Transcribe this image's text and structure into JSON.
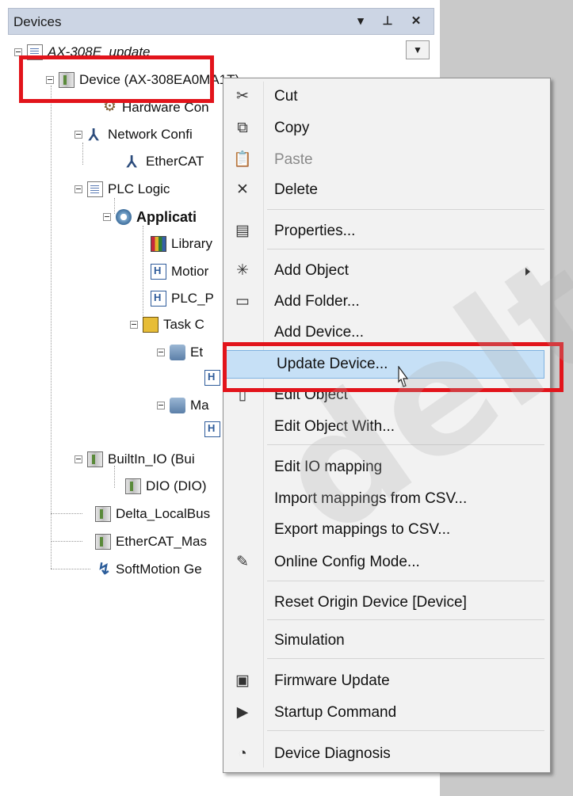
{
  "panel": {
    "title": "Devices",
    "dropdown_icon": "chevron-down-icon",
    "pin_icon": "pin-icon",
    "close_icon": "close-icon"
  },
  "tree": {
    "project": "AX-308E_update",
    "device": "Device (AX-308EA0MA1T)",
    "hardware": "Hardware Con",
    "network": "Network Confi",
    "ethercat": "EtherCAT",
    "plc_logic": "PLC Logic",
    "application": "Applicati",
    "library": "Library",
    "motion": "Motior",
    "plc_prg": "PLC_P",
    "task": "Task C",
    "task_item1": "Et",
    "task_item2": "Ma",
    "builtin_io": "BuiltIn_IO (Bui",
    "dio": "DIO (DIO)",
    "localbus": "Delta_LocalBus",
    "ethercat_master": "EtherCAT_Mas",
    "softmotion": "SoftMotion Ge"
  },
  "menu": {
    "items": [
      {
        "label": "Cut",
        "icon": "scissors-icon",
        "enabled": true
      },
      {
        "label": "Copy",
        "icon": "copy-icon",
        "enabled": true
      },
      {
        "label": "Paste",
        "icon": "paste-icon",
        "enabled": false
      },
      {
        "label": "Delete",
        "icon": "delete-icon",
        "enabled": true
      },
      {
        "label": "Properties...",
        "icon": "properties-icon",
        "enabled": true
      },
      {
        "label": "Add Object",
        "icon": "add-object-icon",
        "enabled": true,
        "submenu": true
      },
      {
        "label": "Add Folder...",
        "icon": "folder-icon",
        "enabled": true
      },
      {
        "label": "Add Device...",
        "icon": "",
        "enabled": true
      },
      {
        "label": "Update Device...",
        "icon": "",
        "enabled": true,
        "selected": true
      },
      {
        "label": "Edit Object",
        "icon": "edit-object-icon",
        "enabled": true
      },
      {
        "label": "Edit Object With...",
        "icon": "",
        "enabled": true
      },
      {
        "label": "Edit IO mapping",
        "icon": "",
        "enabled": true
      },
      {
        "label": "Import mappings from CSV...",
        "icon": "",
        "enabled": true
      },
      {
        "label": "Export mappings to CSV...",
        "icon": "",
        "enabled": true
      },
      {
        "label": "Online Config Mode...",
        "icon": "online-config-icon",
        "enabled": true
      },
      {
        "label": "Reset Origin Device [Device]",
        "icon": "",
        "enabled": true
      },
      {
        "label": "Simulation",
        "icon": "",
        "enabled": true
      },
      {
        "label": "Firmware Update",
        "icon": "firmware-icon",
        "enabled": true
      },
      {
        "label": "Startup Command",
        "icon": "startup-command-icon",
        "enabled": true
      },
      {
        "label": "Device Diagnosis",
        "icon": "diagnosis-icon",
        "enabled": true
      }
    ]
  },
  "annotation_color": "#e2141b",
  "watermark": "deltro"
}
